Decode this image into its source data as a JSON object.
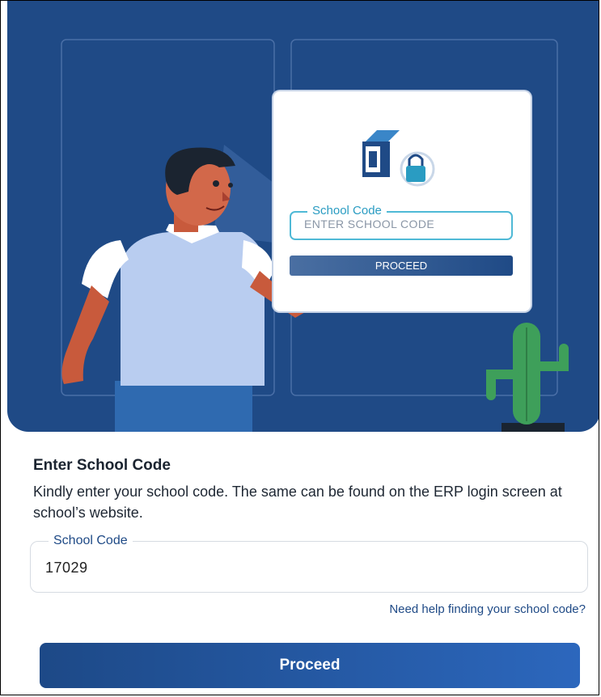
{
  "illustration": {
    "card": {
      "field_label": "School Code",
      "field_placeholder": "ENTER SCHOOL CODE",
      "button_label": "PROCEED"
    }
  },
  "form": {
    "title": "Enter School Code",
    "description": "Kindly enter your school code. The same can be found on the ERP login screen at school’s website.",
    "school_code": {
      "label": "School Code",
      "value": "17029"
    },
    "help_link": "Need help finding your school code?",
    "proceed_button": "Proceed"
  },
  "colors": {
    "hero_background": "#1f4a86",
    "accent": "#1f4a86",
    "button_gradient_start": "#1d4987",
    "button_gradient_end": "#2c67bd"
  }
}
